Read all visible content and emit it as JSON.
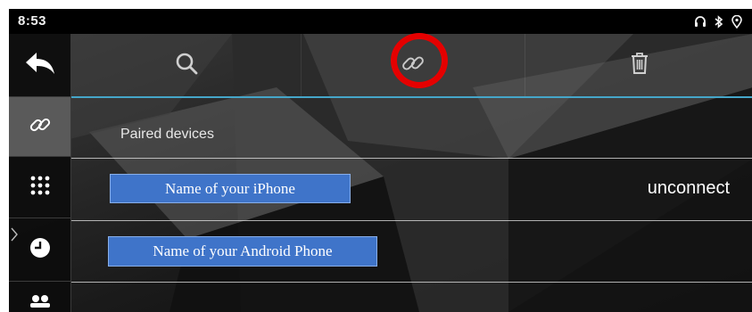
{
  "status_bar": {
    "time": "8:53",
    "icons": [
      "headphones-icon",
      "bluetooth-icon",
      "location-icon"
    ]
  },
  "sidebar": {
    "items": [
      {
        "name": "back-icon",
        "active": false
      },
      {
        "name": "link-icon",
        "active": true
      },
      {
        "name": "dialpad-icon",
        "active": false
      },
      {
        "name": "clock-icon",
        "active": false
      },
      {
        "name": "contacts-icon",
        "active": false
      }
    ]
  },
  "toolbar": {
    "buttons": [
      {
        "name": "search-icon"
      },
      {
        "name": "link-icon",
        "highlighted": true
      },
      {
        "name": "trash-icon"
      }
    ],
    "accent_color": "#45a6c9",
    "highlight_color": "#e50000"
  },
  "content": {
    "section_title": "Paired devices",
    "devices": [
      {
        "name": "Name of your iPhone",
        "action": "unconnect"
      },
      {
        "name": "Name of your Android Phone",
        "action": ""
      }
    ],
    "label_color": "#3f74c9"
  }
}
